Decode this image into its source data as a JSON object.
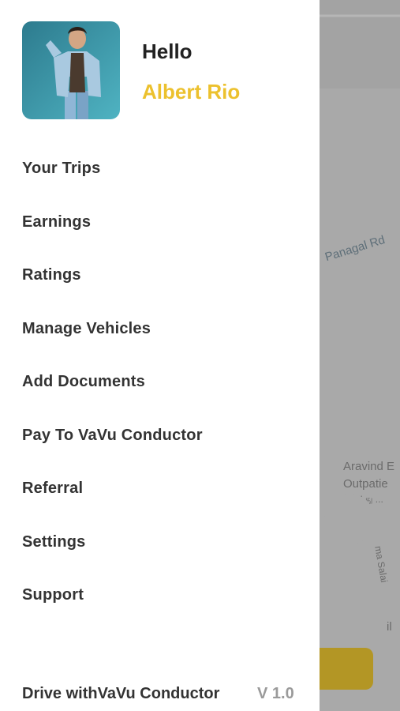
{
  "drawer": {
    "greeting": "Hello",
    "user_name": "Albert Rio",
    "menu_items": [
      {
        "label": "Your Trips"
      },
      {
        "label": "Earnings"
      },
      {
        "label": "Ratings"
      },
      {
        "label": "Manage Vehicles"
      },
      {
        "label": "Add Documents"
      },
      {
        "label": "Pay To VaVu Conductor"
      },
      {
        "label": "Referral"
      },
      {
        "label": "Settings"
      },
      {
        "label": "Support"
      }
    ],
    "footer": {
      "brand": "Drive withVaVu Conductor",
      "version": "V 1.0"
    }
  },
  "map": {
    "road_label": "Panagal Rd",
    "poi_name_line1": "Aravind E",
    "poi_name_line2": "Outpatie",
    "poi_sub": "ூத்து ...",
    "road2_label": "ma Salai",
    "fragment_label": "il"
  },
  "colors": {
    "accent": "#ecc12e",
    "text_primary": "#333333",
    "text_muted": "#9a9a9a",
    "overlay_map": "#a3a3a3"
  },
  "icons": {
    "avatar": "user-photo",
    "hospital": "hospital-pin-icon",
    "locate": "crosshair-icon"
  }
}
